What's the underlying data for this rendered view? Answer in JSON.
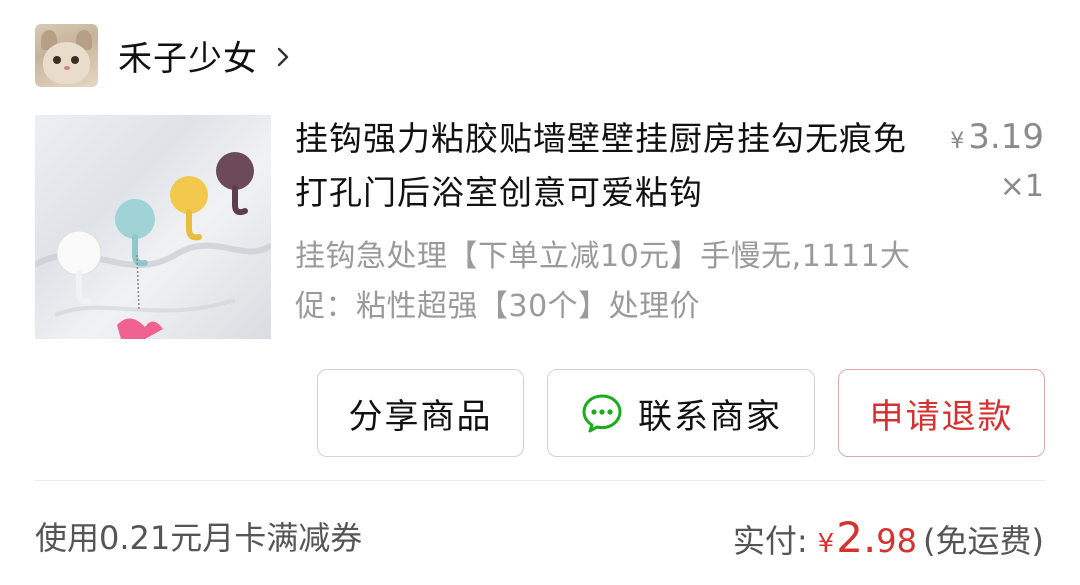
{
  "shop": {
    "name": "禾子少女"
  },
  "product": {
    "title": "挂钩强力粘胶贴墙壁壁挂厨房挂勾无痕免打孔门后浴室创意可爱粘钩",
    "spec": "挂钩急处理【下单立减10元】手慢无,1111大促：粘性超强【30个】处理价",
    "price_symbol": "¥",
    "price": "3.19",
    "quantity": "×1"
  },
  "buttons": {
    "share": "分享商品",
    "contact": "联系商家",
    "refund": "申请退款"
  },
  "footer": {
    "coupon": "使用0.21元月卡满减券",
    "paid_label": "实付:",
    "paid_symbol": "¥",
    "paid_int": "2.",
    "paid_dec": "98",
    "shipping": "(免运费)"
  },
  "colors": {
    "accent_red": "#d5312f",
    "wechat_green": "#1aad19"
  },
  "icons": {
    "chevron": "chevron-right-icon",
    "wechat": "wechat-chat-icon"
  }
}
